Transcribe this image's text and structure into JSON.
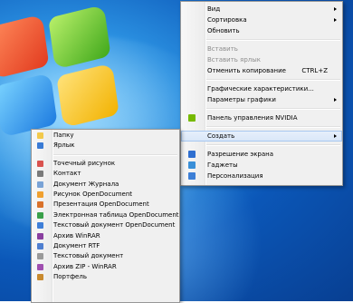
{
  "main_menu": {
    "items": [
      {
        "label": "Вид",
        "submenu": true
      },
      {
        "label": "Сортировка",
        "submenu": true
      },
      {
        "label": "Обновить"
      },
      {
        "sep": true
      },
      {
        "label": "Вставить",
        "disabled": true
      },
      {
        "label": "Вставить ярлык",
        "disabled": true
      },
      {
        "label": "Отменить копирование",
        "shortcut": "CTRL+Z"
      },
      {
        "sep": true
      },
      {
        "label": "Графические характеристики..."
      },
      {
        "label": "Параметры графики",
        "submenu": true
      },
      {
        "sep": true
      },
      {
        "label": "Панель управления NVIDIA",
        "icon": "nvidia-icon"
      },
      {
        "sep": true
      },
      {
        "label": "Создать",
        "submenu": true,
        "hover": true
      },
      {
        "sep": true
      },
      {
        "label": "Разрешение экрана",
        "icon": "screen-resolution-icon"
      },
      {
        "label": "Гаджеты",
        "icon": "gadgets-icon"
      },
      {
        "label": "Персонализация",
        "icon": "personalization-icon"
      }
    ]
  },
  "create_menu": {
    "items": [
      {
        "label": "Папку",
        "icon": "folder-icon"
      },
      {
        "label": "Ярлык",
        "icon": "shortcut-icon"
      },
      {
        "sep": true
      },
      {
        "label": "Точечный рисунок",
        "icon": "bitmap-icon"
      },
      {
        "label": "Контакт",
        "icon": "contact-icon"
      },
      {
        "label": "Документ Журнала",
        "icon": "journal-icon"
      },
      {
        "label": "Рисунок OpenDocument",
        "icon": "odg-icon"
      },
      {
        "label": "Презентация OpenDocument",
        "icon": "odp-icon"
      },
      {
        "label": "Электронная таблица OpenDocument",
        "icon": "ods-icon"
      },
      {
        "label": "Текстовый документ OpenDocument",
        "icon": "odt-icon"
      },
      {
        "label": "Архив WinRAR",
        "icon": "winrar-icon"
      },
      {
        "label": "Документ RTF",
        "icon": "rtf-icon"
      },
      {
        "label": "Текстовый документ",
        "icon": "txt-icon"
      },
      {
        "label": "Архив ZIP - WinRAR",
        "icon": "zip-icon"
      },
      {
        "label": "Портфель",
        "icon": "briefcase-icon"
      }
    ]
  },
  "icon_colors": {
    "nvidia-icon": "#76b900",
    "screen-resolution-icon": "#2f6fd0",
    "gadgets-icon": "#3a8fd8",
    "personalization-icon": "#3d7fd6",
    "folder-icon": "#f2c94c",
    "shortcut-icon": "#3a7bd5",
    "bitmap-icon": "#d9534f",
    "contact-icon": "#7a7a7a",
    "journal-icon": "#7aa3d6",
    "odg-icon": "#f0a030",
    "odp-icon": "#d9722b",
    "ods-icon": "#3aa04a",
    "odt-icon": "#3f7fd8",
    "winrar-icon": "#8a3fa0",
    "rtf-icon": "#4f7fd0",
    "txt-icon": "#9a9a9a",
    "zip-icon": "#a04fb0",
    "briefcase-icon": "#c98a2e"
  }
}
